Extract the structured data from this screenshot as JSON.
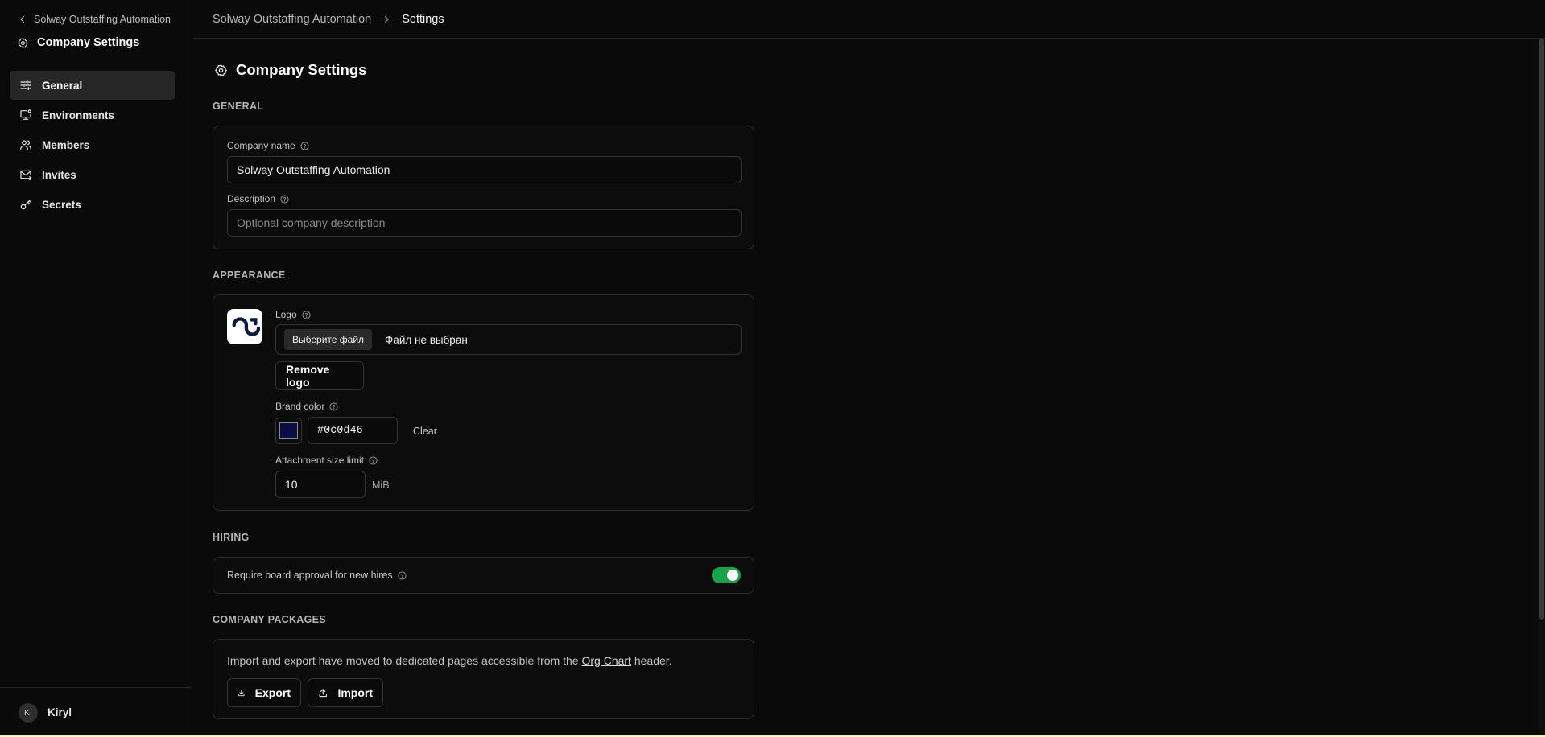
{
  "sidebar": {
    "back_label": "Solway Outstaffing Automation",
    "title": "Company Settings",
    "items": [
      {
        "label": "General",
        "icon": "sliders-icon",
        "active": true
      },
      {
        "label": "Environments",
        "icon": "monitor-icon",
        "active": false
      },
      {
        "label": "Members",
        "icon": "users-icon",
        "active": false
      },
      {
        "label": "Invites",
        "icon": "mail-icon",
        "active": false
      },
      {
        "label": "Secrets",
        "icon": "key-icon",
        "active": false
      }
    ],
    "user": {
      "initials": "KI",
      "name": "Kiryl"
    }
  },
  "breadcrumb": {
    "parent": "Solway Outstaffing Automation",
    "current": "Settings"
  },
  "page": {
    "title": "Company Settings"
  },
  "general": {
    "section_label": "GENERAL",
    "company_name_label": "Company name",
    "company_name_value": "Solway Outstaffing Automation",
    "description_label": "Description",
    "description_placeholder": "Optional company description"
  },
  "appearance": {
    "section_label": "APPEARANCE",
    "logo_label": "Logo",
    "file_button": "Выберите файл",
    "file_status": "Файл не выбран",
    "remove_logo": "Remove logo",
    "brand_color_label": "Brand color",
    "brand_color_value": "#0c0d46",
    "clear": "Clear",
    "attachment_label": "Attachment size limit",
    "attachment_value": "10",
    "attachment_unit": "MiB"
  },
  "hiring": {
    "section_label": "HIRING",
    "board_approval_label": "Require board approval for new hires",
    "board_approval_enabled": true
  },
  "packages": {
    "section_label": "COMPANY PACKAGES",
    "text_before": "Import and export have moved to dedicated pages accessible from the ",
    "link": "Org Chart",
    "text_after": " header.",
    "export": "Export",
    "import": "Import"
  },
  "colors": {
    "background": "#0a0a0a",
    "active_nav": "#262626",
    "toggle_on": "#16a34a",
    "brand": "#0c0d46"
  }
}
